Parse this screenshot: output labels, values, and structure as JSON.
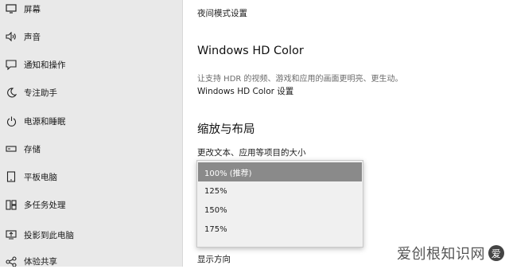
{
  "sidebar": {
    "items": [
      {
        "label": "屏幕",
        "icon": "monitor-icon"
      },
      {
        "label": "声音",
        "icon": "speaker-icon"
      },
      {
        "label": "通知和操作",
        "icon": "notification-icon"
      },
      {
        "label": "专注助手",
        "icon": "moon-icon"
      },
      {
        "label": "电源和睡眠",
        "icon": "power-icon"
      },
      {
        "label": "存储",
        "icon": "storage-icon"
      },
      {
        "label": "平板电脑",
        "icon": "tablet-icon"
      },
      {
        "label": "多任务处理",
        "icon": "multitask-icon"
      },
      {
        "label": "投影到此电脑",
        "icon": "project-icon"
      },
      {
        "label": "体验共享",
        "icon": "share-icon"
      }
    ]
  },
  "content": {
    "night_mode_link": "夜间模式设置",
    "hdr_title": "Windows HD Color",
    "hdr_desc": "让支持 HDR 的视频、游戏和应用的画面更明亮、更生动。",
    "hdr_link": "Windows HD Color 设置",
    "scale_title": "缩放与布局",
    "scale_label": "更改文本、应用等项目的大小",
    "orientation_label": "显示方向"
  },
  "scale_dropdown": {
    "options": [
      "100% (推荐)",
      "125%",
      "150%",
      "175%"
    ],
    "selected": "100% (推荐)"
  },
  "watermark": {
    "text": "爱创根知识网"
  }
}
